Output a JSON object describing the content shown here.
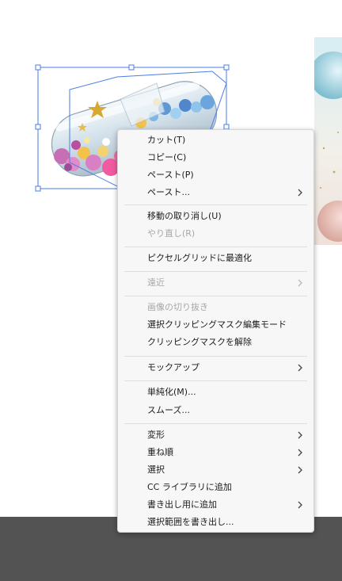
{
  "menu": {
    "items": [
      {
        "label": "カット(T)",
        "enabled": true,
        "submenu": false
      },
      {
        "label": "コピー(C)",
        "enabled": true,
        "submenu": false
      },
      {
        "label": "ペースト(P)",
        "enabled": true,
        "submenu": false
      },
      {
        "label": "ペースト...",
        "enabled": true,
        "submenu": true
      },
      {
        "label": "移動の取り消し(U)",
        "enabled": true,
        "submenu": false
      },
      {
        "label": "やり直し(R)",
        "enabled": false,
        "submenu": false
      },
      {
        "label": "ピクセルグリッドに最適化",
        "enabled": true,
        "submenu": false
      },
      {
        "label": "遠近",
        "enabled": false,
        "submenu": true
      },
      {
        "label": "画像の切り抜き",
        "enabled": false,
        "submenu": false
      },
      {
        "label": "選択クリッピングマスク編集モード",
        "enabled": true,
        "submenu": false
      },
      {
        "label": "クリッピングマスクを解除",
        "enabled": true,
        "submenu": false
      },
      {
        "label": "モックアップ",
        "enabled": true,
        "submenu": true
      },
      {
        "label": "単純化(M)...",
        "enabled": true,
        "submenu": false
      },
      {
        "label": "スムーズ...",
        "enabled": true,
        "submenu": false
      },
      {
        "label": "変形",
        "enabled": true,
        "submenu": true
      },
      {
        "label": "重ね順",
        "enabled": true,
        "submenu": true
      },
      {
        "label": "選択",
        "enabled": true,
        "submenu": true
      },
      {
        "label": "CC ライブラリに追加",
        "enabled": true,
        "submenu": false
      },
      {
        "label": "書き出し用に追加",
        "enabled": true,
        "submenu": true
      },
      {
        "label": "選択範囲を書き出し...",
        "enabled": true,
        "submenu": false
      }
    ]
  },
  "colors": {
    "menu_background": "#f7f7f7",
    "text": "#1b1b1b",
    "disabled_text": "#a7a7a7",
    "selection": "#4a7de8",
    "pasteboard": "#535353"
  },
  "canvas": {
    "selected_object": "pill-capsule-image",
    "selection_color": "#4a7de8"
  }
}
